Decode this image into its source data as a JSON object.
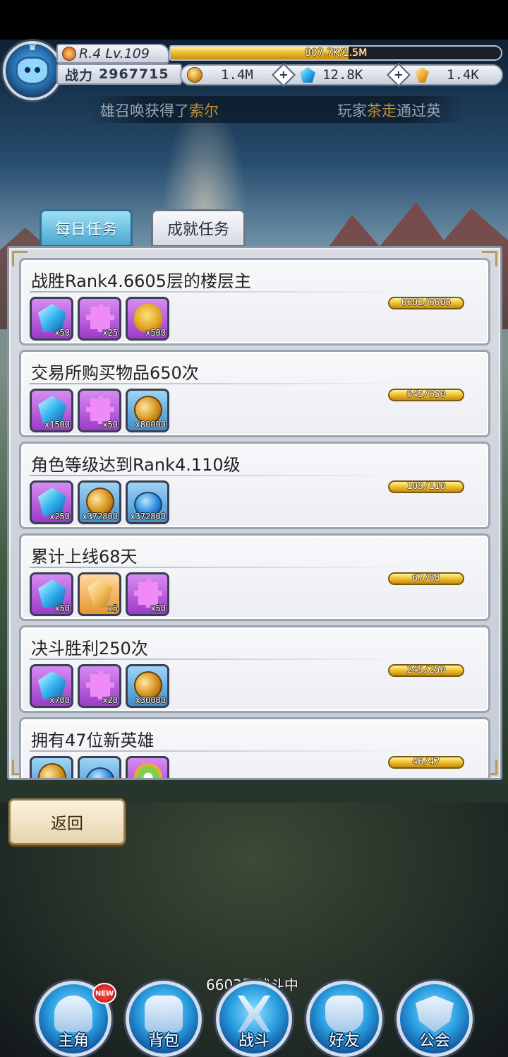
{
  "player": {
    "rank_level": "R.4 Lv.109",
    "exp_text": "807.7K/1.5M",
    "exp_progress": 0.538,
    "power_label": "战力",
    "power_value": "2967715"
  },
  "resources": [
    {
      "icon": "coin-icon",
      "value": "1.4M"
    },
    {
      "icon": "gem-icon",
      "value": "12.8K"
    },
    {
      "icon": "crystal-icon",
      "value": "1.4K"
    }
  ],
  "marquee": {
    "msg1_prefix": "雄召唤获得了",
    "msg1_highlight": "索尔",
    "msg2_prefix": "玩家",
    "msg2_highlight": "茶走",
    "msg2_suffix": "通过英"
  },
  "tabs": {
    "daily": "每日任务",
    "achievement": "成就任务",
    "active": "achievement"
  },
  "quests": [
    {
      "title": "战胜Rank4.6605层的楼层主",
      "progress_text": "6602/6605",
      "progress": 0.9995,
      "rewards": [
        {
          "icon": "gem-icon",
          "frame": "purple",
          "qty": "x50"
        },
        {
          "icon": "puzzle-piece-icon",
          "frame": "purple",
          "qty": "x25"
        },
        {
          "icon": "gold-bag-icon",
          "frame": "purple",
          "qty": "x500"
        }
      ]
    },
    {
      "title": "交易所购买物品650次",
      "progress_text": "645/650",
      "progress": 0.992,
      "rewards": [
        {
          "icon": "gem-icon",
          "frame": "purple",
          "qty": "x1500"
        },
        {
          "icon": "puzzle-piece-icon",
          "frame": "purple",
          "qty": "x50"
        },
        {
          "icon": "coin-icon",
          "frame": "blue",
          "qty": "x80000"
        }
      ]
    },
    {
      "title": "角色等级达到Rank4.110级",
      "progress_text": "109/110",
      "progress": 0.991,
      "rewards": [
        {
          "icon": "gem-icon",
          "frame": "purple",
          "qty": "x250"
        },
        {
          "icon": "coin-icon",
          "frame": "blue",
          "qty": "x372800"
        },
        {
          "icon": "potion-icon",
          "frame": "blue",
          "qty": "x372800"
        }
      ]
    },
    {
      "title": "累计上线68天",
      "progress_text": "67/68",
      "progress": 0.985,
      "rewards": [
        {
          "icon": "gem-icon",
          "frame": "purple",
          "qty": "x50"
        },
        {
          "icon": "crystal-icon",
          "frame": "orange",
          "qty": "x5"
        },
        {
          "icon": "puzzle-piece-icon",
          "frame": "purple",
          "qty": "x50"
        }
      ]
    },
    {
      "title": "决斗胜利250次",
      "progress_text": "245/250",
      "progress": 0.98,
      "rewards": [
        {
          "icon": "gem-icon",
          "frame": "purple",
          "qty": "x700"
        },
        {
          "icon": "puzzle-piece-icon",
          "frame": "purple",
          "qty": "x20"
        },
        {
          "icon": "coin-icon",
          "frame": "blue",
          "qty": "x30000"
        }
      ]
    },
    {
      "title": "拥有47位新英雄",
      "progress_text": "46/47",
      "progress": 0.979,
      "rewards": [
        {
          "icon": "coin-icon",
          "frame": "blue",
          "qty": ""
        },
        {
          "icon": "potion-icon",
          "frame": "blue",
          "qty": ""
        },
        {
          "icon": "gear-icon",
          "frame": "purple",
          "qty": ""
        }
      ]
    }
  ],
  "back_button": "返回",
  "battle_status": "6603层战斗中",
  "nav": [
    {
      "key": "hero",
      "label": "主角",
      "badge": "NEW"
    },
    {
      "key": "bag",
      "label": "背包"
    },
    {
      "key": "battle",
      "label": "战斗"
    },
    {
      "key": "friend",
      "label": "好友"
    },
    {
      "key": "guild",
      "label": "公会"
    }
  ]
}
